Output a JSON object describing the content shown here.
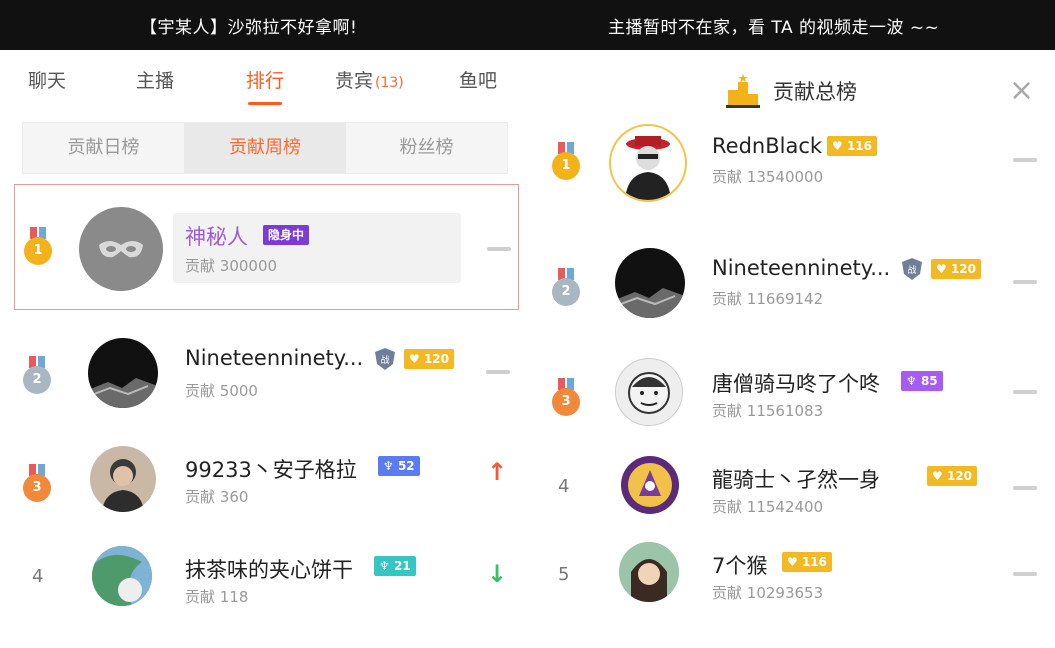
{
  "topbar": {
    "left_text": "【宇某人】沙弥拉不好拿啊!",
    "right_text": "主播暂时不在家，看 TA 的视频走一波 ~~"
  },
  "tabs": [
    {
      "label": "聊天"
    },
    {
      "label": "主播"
    },
    {
      "label": "排行",
      "active": true
    },
    {
      "label": "贵宾",
      "count": "(13)"
    },
    {
      "label": "鱼吧"
    }
  ],
  "subtabs": [
    {
      "label": "贡献日榜"
    },
    {
      "label": "贡献周榜",
      "active": true
    },
    {
      "label": "粉丝榜"
    }
  ],
  "left_list": [
    {
      "rank": "1",
      "name": "神秘人",
      "badge": "隐身中",
      "contrib_label": "贡献",
      "contrib": "300000",
      "trend": "none"
    },
    {
      "rank": "2",
      "name": "Nineteenninety...",
      "badge": "120",
      "contrib_label": "贡献",
      "contrib": "5000",
      "trend": "none"
    },
    {
      "rank": "3",
      "name": "99233丶安子格拉",
      "badge": "52",
      "contrib_label": "贡献",
      "contrib": "360",
      "trend": "up"
    },
    {
      "rank": "4",
      "name": "抹茶味的夹心饼干",
      "badge": "21",
      "contrib_label": "贡献",
      "contrib": "118",
      "trend": "down"
    }
  ],
  "right_panel": {
    "title": "贡献总榜",
    "list": [
      {
        "rank": "1",
        "name": "RednBlack",
        "badge": "116",
        "contrib_label": "贡献",
        "contrib": "13540000"
      },
      {
        "rank": "2",
        "name": "Nineteenninety...",
        "badge": "120",
        "contrib_label": "贡献",
        "contrib": "11669142"
      },
      {
        "rank": "3",
        "name": "唐僧骑马咚了个咚",
        "badge": "85",
        "contrib_label": "贡献",
        "contrib": "11561083"
      },
      {
        "rank": "4",
        "name": "龍骑士丶孑然一身",
        "badge": "120",
        "contrib_label": "贡献",
        "contrib": "11542400"
      },
      {
        "rank": "5",
        "name": "7个猴",
        "badge": "116",
        "contrib_label": "贡献",
        "contrib": "10293653"
      }
    ]
  },
  "colors": {
    "accent": "#ff5a1f",
    "gold_medal": "#f4b21a",
    "silver_medal": "#a9b7c3",
    "bronze_medal": "#f08a3a",
    "up_arrow": "#f05a3a",
    "down_arrow": "#3bbf6a"
  }
}
